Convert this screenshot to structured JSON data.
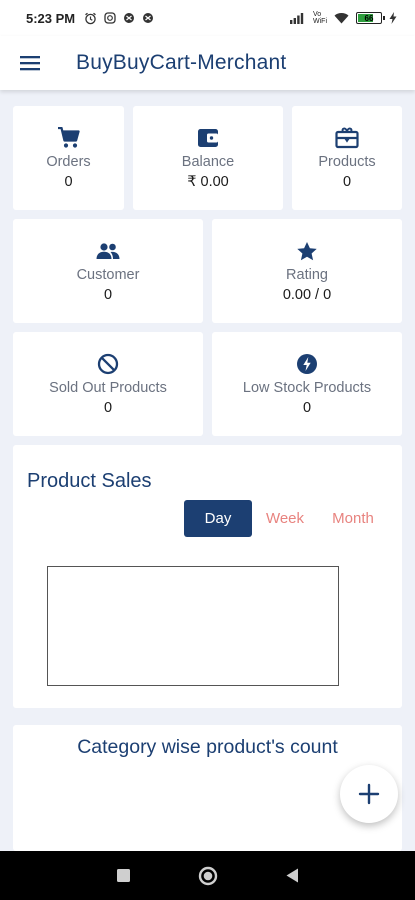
{
  "status_bar": {
    "time": "5:23 PM",
    "network_label": "Vo WiFi",
    "battery_level": "66"
  },
  "app_bar": {
    "title": "BuyBuyCart-Merchant"
  },
  "stats": {
    "orders": {
      "label": "Orders",
      "value": "0",
      "icon": "shopping-cart-icon"
    },
    "balance": {
      "label": "Balance",
      "value": "₹ 0.00",
      "icon": "wallet-icon"
    },
    "products": {
      "label": "Products",
      "value": "0",
      "icon": "product-box-icon"
    },
    "customer": {
      "label": "Customer",
      "value": "0",
      "icon": "people-icon"
    },
    "rating": {
      "label": "Rating",
      "value": "0.00 / 0",
      "icon": "star-icon"
    },
    "sold_out": {
      "label": "Sold Out Products",
      "value": "0",
      "icon": "block-icon"
    },
    "low_stock": {
      "label": "Low Stock Products",
      "value": "0",
      "icon": "lightning-icon"
    }
  },
  "product_sales": {
    "title": "Product Sales",
    "periods": [
      "Day",
      "Week",
      "Month"
    ],
    "selected": "Day"
  },
  "category_section": {
    "title": "Category wise product's count"
  },
  "colors": {
    "primary": "#1c3f72",
    "accent_inactive": "#e8837f",
    "background": "#eef1f8",
    "card": "#ffffff"
  }
}
